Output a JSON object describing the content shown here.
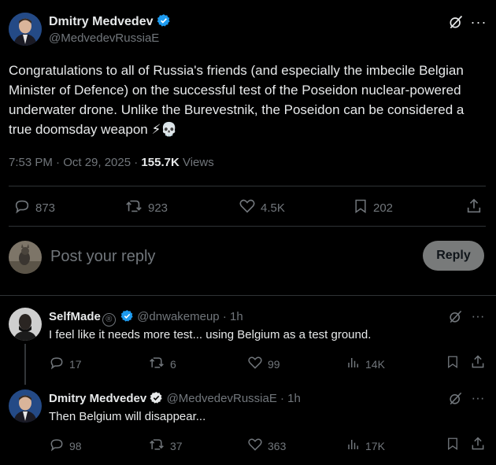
{
  "main_post": {
    "author_name": "Dmitry Medvedev",
    "handle": "@MedvedevRussiaE",
    "text": "Congratulations to all of Russia's friends (and especially the imbecile Belgian Minister of Defence) on the successful test of the Poseidon nuclear-powered underwater drone. Unlike the Burevestnik, the Poseidon can be considered a true doomsday weapon",
    "emojis": "⚡💀",
    "time": "7:53 PM · Oct 29, 2025 · ",
    "views_count": "155.7K",
    "views_label": " Views",
    "replies": "873",
    "reposts": "923",
    "likes": "4.5K",
    "bookmarks": "202"
  },
  "reply_box": {
    "placeholder": "Post your reply",
    "button_label": "Reply"
  },
  "replies": [
    {
      "author_name": "SelfMade",
      "name_badge": "®",
      "handle_time": "@dnwakemeup · 1h",
      "text": "I feel like it needs more test... using Belgium as a test ground.",
      "replies": "17",
      "reposts": "6",
      "likes": "99",
      "views": "14K"
    },
    {
      "author_name": "Dmitry Medvedev",
      "handle_time": "@MedvedevRussiaE · 1h",
      "text": "Then Belgium will disappear...",
      "replies": "98",
      "reposts": "37",
      "likes": "363",
      "views": "17K"
    }
  ],
  "colors": {
    "background": "#000000",
    "text": "#e7e9ea",
    "muted": "#71767b",
    "verified": "#1d9bf0",
    "divider": "#2f3336",
    "reply_button_bg": "#787a7a"
  }
}
